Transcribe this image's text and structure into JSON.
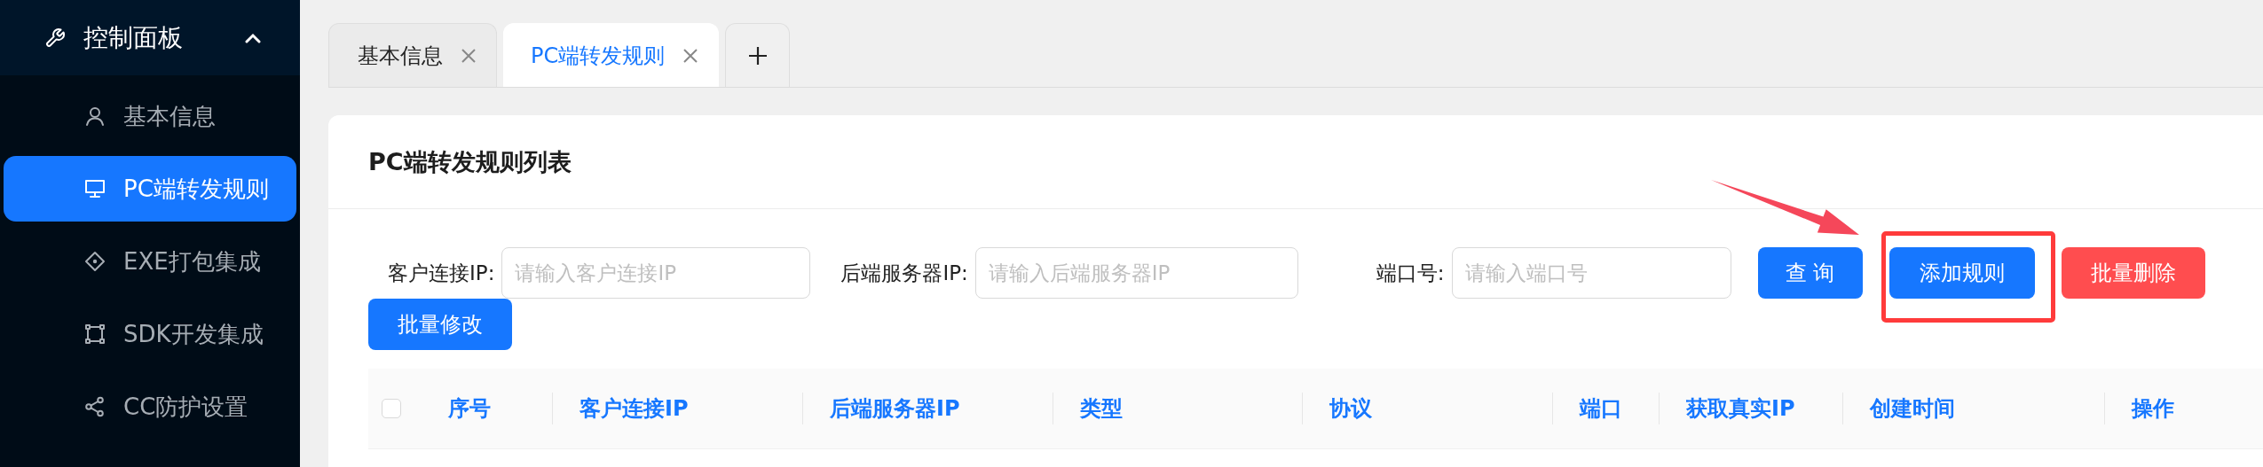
{
  "sidebar": {
    "group": {
      "label": "控制面板",
      "expanded": true
    },
    "items": [
      {
        "label": "基本信息",
        "selected": false
      },
      {
        "label": "PC端转发规则",
        "selected": true
      },
      {
        "label": "EXE打包集成",
        "selected": false
      },
      {
        "label": "SDK开发集成",
        "selected": false
      },
      {
        "label": "CC防护设置",
        "selected": false
      }
    ]
  },
  "tabs": [
    {
      "label": "基本信息",
      "selected": false
    },
    {
      "label": "PC端转发规则",
      "selected": true
    }
  ],
  "card": {
    "title": "PC端转发规则列表"
  },
  "filters": [
    {
      "label": "客户连接IP:",
      "placeholder": "请输入客户连接IP"
    },
    {
      "label": "后端服务器IP:",
      "placeholder": "请输入后端服务器IP"
    },
    {
      "label": "端口号:",
      "placeholder": "请输入端口号"
    }
  ],
  "buttons": [
    {
      "label": "查 询",
      "kind": "primary",
      "highlighted": false
    },
    {
      "label": "添加规则",
      "kind": "primary",
      "highlighted": true
    },
    {
      "label": "批量删除",
      "kind": "danger",
      "highlighted": false
    },
    {
      "label": "批量修改",
      "kind": "primary",
      "highlighted": false
    }
  ],
  "table": {
    "select_all": {
      "checked": false
    },
    "columns": [
      "序号",
      "客户连接IP",
      "后端服务器IP",
      "类型",
      "协议",
      "端口",
      "获取真实IP",
      "创建时间",
      "操作"
    ]
  }
}
